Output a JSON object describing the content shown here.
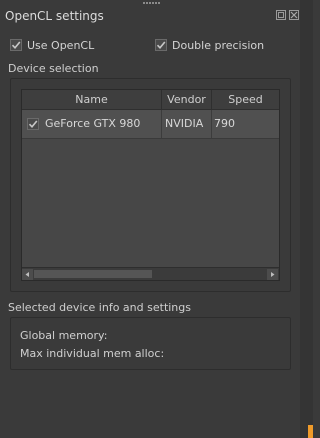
{
  "window": {
    "title": "OpenCL settings"
  },
  "options": {
    "use_opencl": {
      "label": "Use OpenCL",
      "checked": true
    },
    "double_precision": {
      "label": "Double precision",
      "checked": true
    }
  },
  "device_selection": {
    "title": "Device selection",
    "columns": [
      "Name",
      "Vendor",
      "Speed"
    ],
    "rows": [
      {
        "checked": true,
        "name": "GeForce GTX 980",
        "vendor": "NVIDIA",
        "speed": "790"
      }
    ]
  },
  "device_info": {
    "title": "Selected device info and settings",
    "global_memory_label": "Global memory:",
    "max_alloc_label": "Max individual mem alloc:"
  },
  "colors": {
    "accent": "#f09b2a",
    "background": "#3a3a3a"
  },
  "icons": [
    "float-icon",
    "close-icon",
    "checkmark-icon",
    "scroll-left-icon",
    "scroll-right-icon"
  ]
}
